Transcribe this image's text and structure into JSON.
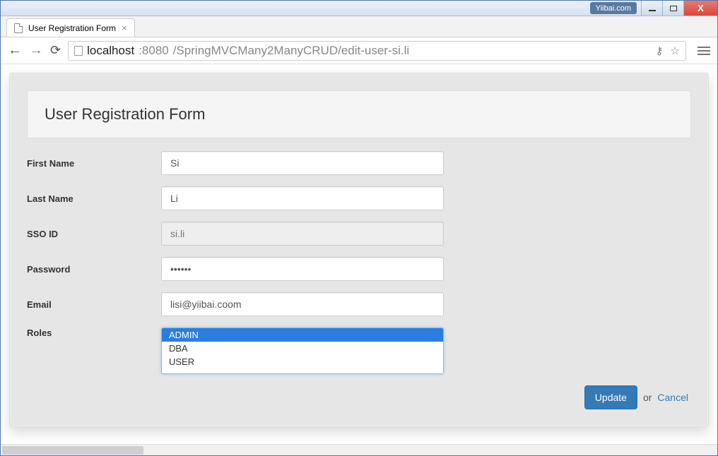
{
  "window": {
    "badge": "Yiibai.com"
  },
  "tab": {
    "title": "User Registration Form"
  },
  "addressbar": {
    "host": "localhost",
    "port": ":8080",
    "path": "/SpringMVCMany2ManyCRUD/edit-user-si.li"
  },
  "page": {
    "header": "User Registration Form",
    "labels": {
      "first_name": "First Name",
      "last_name": "Last Name",
      "sso_id": "SSO ID",
      "password": "Password",
      "email": "Email",
      "roles": "Roles"
    },
    "values": {
      "first_name": "Si",
      "last_name": "Li",
      "sso_id": "si.li",
      "password": "••••••",
      "email": "lisi@yiibai.coom"
    },
    "roles": {
      "options": [
        "ADMIN",
        "DBA",
        "USER"
      ],
      "selected": [
        "ADMIN"
      ]
    },
    "actions": {
      "submit": "Update",
      "or": "or",
      "cancel": "Cancel"
    }
  }
}
